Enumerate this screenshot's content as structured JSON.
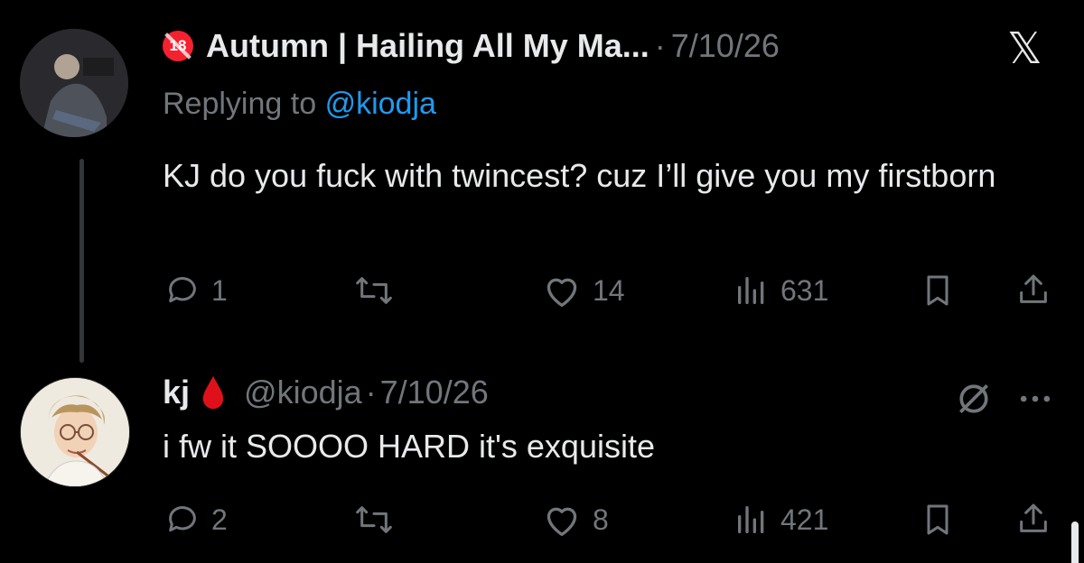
{
  "tweet1": {
    "badge": "18",
    "display_name": "Autumn | Hailing All My Ma...",
    "separator": "·",
    "date": "7/10/26",
    "replying_prefix": "Replying to",
    "replying_handle": "@kiodja",
    "text": "KJ do you fuck with twincest? cuz I’ll give you my firstborn",
    "replies": "1",
    "retweets": "",
    "likes": "14",
    "views": "631"
  },
  "tweet2": {
    "display_name": "kj",
    "handle": "@kiodja",
    "separator": "·",
    "date": "7/10/26",
    "text": "i fw it SOOOO HARD it's exquisite",
    "replies": "2",
    "retweets": "",
    "likes": "8",
    "views": "421"
  },
  "icons": {
    "close": "x-logo-icon",
    "reply": "reply-bubble-icon",
    "retweet": "retweet-icon",
    "like": "heart-icon",
    "views": "views-bars-icon",
    "bookmark": "bookmark-icon",
    "share": "share-icon",
    "mute": "muted-icon",
    "more": "more-dots-icon",
    "drop": "blood-drop-icon"
  },
  "colors": {
    "background": "#000000",
    "text": "#e7e9ea",
    "muted": "#71767b",
    "link": "#1d9bf0",
    "badge": "#f4212e",
    "drop": "#e0101a"
  }
}
